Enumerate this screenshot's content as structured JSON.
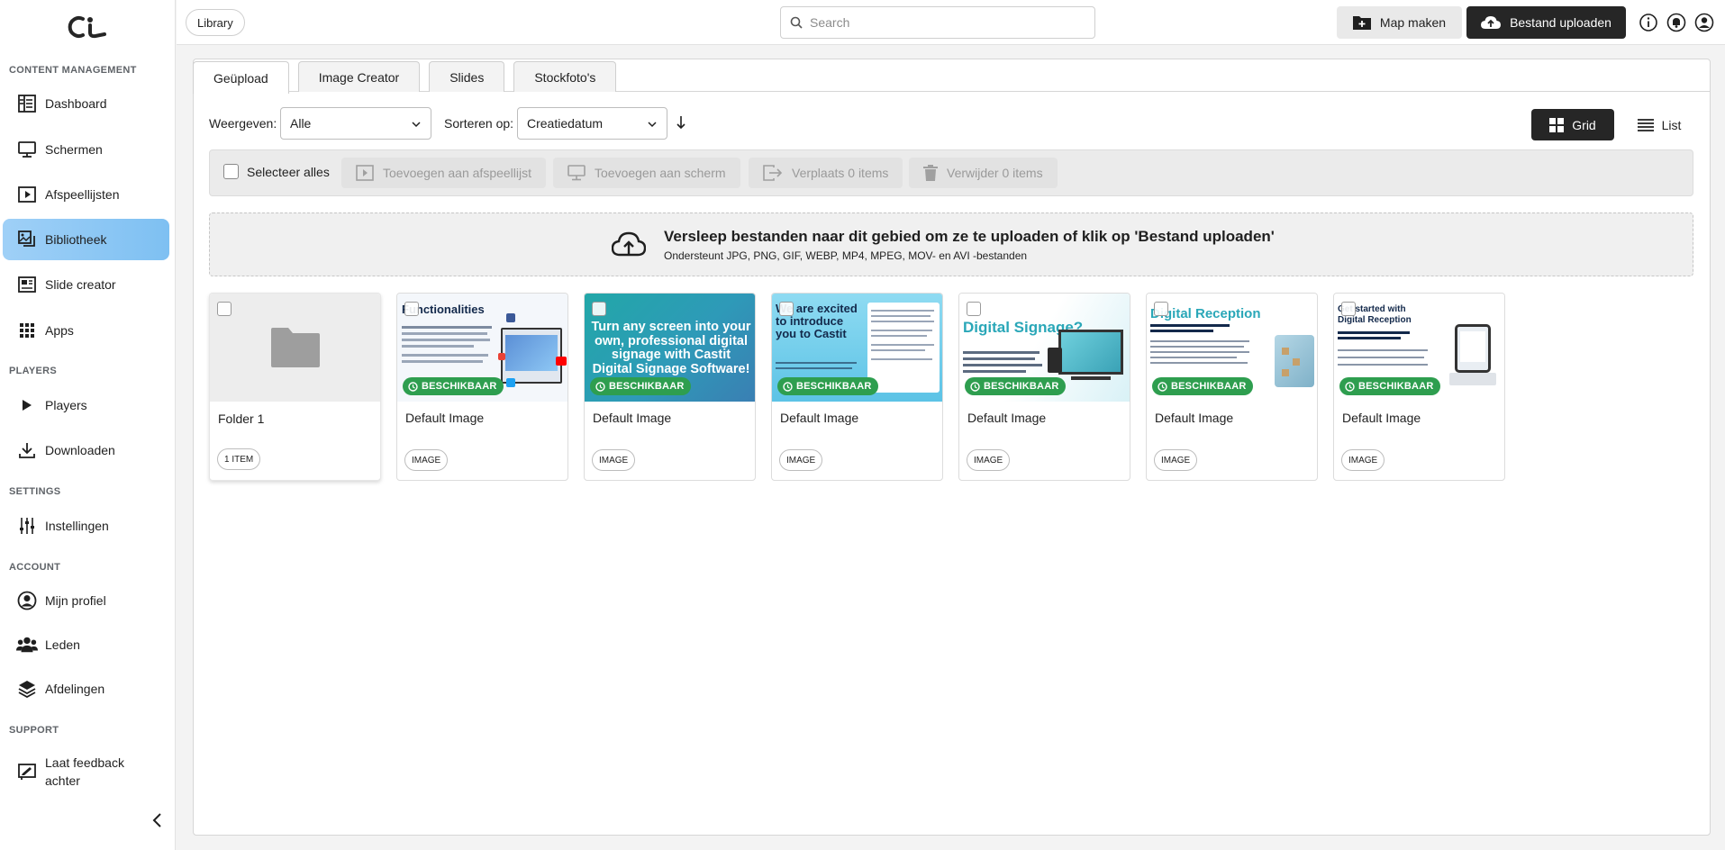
{
  "sidebar": {
    "sections": {
      "content": "CONTENT MANAGEMENT",
      "players": "PLAYERS",
      "settings": "SETTINGS",
      "account": "ACCOUNT",
      "support": "SUPPORT"
    },
    "items": {
      "dashboard": "Dashboard",
      "schermen": "Schermen",
      "afspeellijsten": "Afspeellijsten",
      "bibliotheek": "Bibliotheek",
      "slide_creator": "Slide creator",
      "apps": "Apps",
      "players": "Players",
      "downloaden": "Downloaden",
      "instellingen": "Instellingen",
      "mijn_profiel": "Mijn profiel",
      "leden": "Leden",
      "afdelingen": "Afdelingen",
      "feedback_line1": "Laat feedback",
      "feedback_line2": "achter"
    },
    "active": "Bibliotheek",
    "accent": "#8ec8f5"
  },
  "header": {
    "breadcrumb": "Library",
    "search_placeholder": "Search",
    "map_button": "Map maken",
    "upload_button": "Bestand uploaden"
  },
  "tabs": [
    "Geüpload",
    "Image Creator",
    "Slides",
    "Stockfoto's"
  ],
  "filters": {
    "show_label": "Weergeven:",
    "show_value": "Alle",
    "sort_label": "Sorteren op:",
    "sort_value": "Creatiedatum"
  },
  "view": {
    "grid": "Grid",
    "list": "List"
  },
  "actions": {
    "select_all": "Selecteer alles",
    "add_playlist": "Toevoegen aan afspeellijst",
    "add_screen": "Toevoegen aan scherm",
    "move": "Verplaats 0 items",
    "delete": "Verwijder 0 items"
  },
  "dropzone": {
    "title": "Versleep bestanden naar dit gebied om ze te uploaden of klik op 'Bestand uploaden'",
    "subtitle": "Ondersteunt JPG, PNG, GIF, WEBP, MP4, MPEG, MOV- en AVI -bestanden"
  },
  "folder": {
    "title": "Folder 1",
    "count": "1 ITEM"
  },
  "cards": [
    {
      "title": "Default Image",
      "badge": "BESCHIKBAAR",
      "type": "IMAGE",
      "thumb_text": "Functionalities"
    },
    {
      "title": "Default Image",
      "badge": "BESCHIKBAAR",
      "type": "IMAGE",
      "thumb_text": "Turn any screen into your own, professional digital signage with Castit Digital Signage Software!"
    },
    {
      "title": "Default Image",
      "badge": "BESCHIKBAAR",
      "type": "IMAGE",
      "thumb_text": "We are excited to introduce you to Castit"
    },
    {
      "title": "Default Image",
      "badge": "BESCHIKBAAR",
      "type": "IMAGE",
      "thumb_text": "Digital Signage?"
    },
    {
      "title": "Default Image",
      "badge": "BESCHIKBAAR",
      "type": "IMAGE",
      "thumb_text": "Digital Reception"
    },
    {
      "title": "Default Image",
      "badge": "BESCHIKBAAR",
      "type": "IMAGE",
      "thumb_text": "Get started with Digital Reception"
    }
  ],
  "colors": {
    "dark_button": "#262626",
    "badge_green": "#2e9e4f",
    "teal": "#2aa7b8"
  }
}
